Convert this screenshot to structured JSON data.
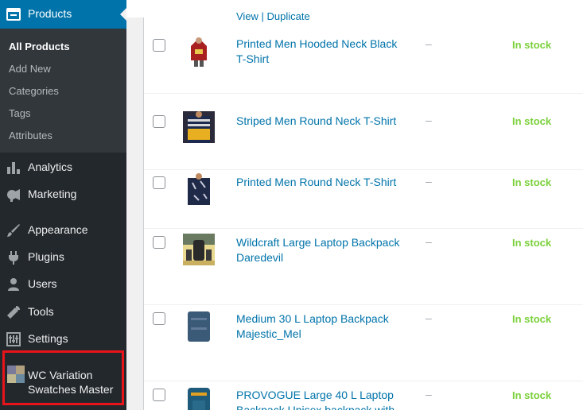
{
  "sidebar": {
    "products_label": "Products",
    "sub_items": [
      "All Products",
      "Add New",
      "Categories",
      "Tags",
      "Attributes"
    ],
    "menu": [
      {
        "label": "Analytics",
        "icon": "analytics-icon"
      },
      {
        "label": "Marketing",
        "icon": "megaphone-icon"
      },
      {
        "label": "Appearance",
        "icon": "brush-icon"
      },
      {
        "label": "Plugins",
        "icon": "plug-icon"
      },
      {
        "label": "Users",
        "icon": "user-icon"
      },
      {
        "label": "Tools",
        "icon": "wrench-icon"
      },
      {
        "label": "Settings",
        "icon": "settings-icon"
      }
    ],
    "wcv_line1": "WC Variation",
    "wcv_line2": "Swatches Master"
  },
  "colors": {
    "sidebar": "#23282d",
    "active": "#0073aa",
    "link": "#0073aa",
    "in_stock": "#7ad03a",
    "highlight_border": "#e8141a"
  },
  "top_row_actions": "View | Duplicate",
  "products": [
    {
      "name_line1": "Printed Men Hooded Neck Black",
      "name_line2": "T-Shirt",
      "price": "–",
      "stock": "In stock"
    },
    {
      "name_line1": "Striped Men Round Neck T-Shirt",
      "name_line2": "",
      "price": "–",
      "stock": "In stock"
    },
    {
      "name_line1": "Printed Men Round Neck T-Shirt",
      "name_line2": "",
      "price": "–",
      "stock": "In stock"
    },
    {
      "name_line1": "Wildcraft Large Laptop Backpack",
      "name_line2": "Daredevil",
      "price": "–",
      "stock": "In stock"
    },
    {
      "name_line1": "Medium 30 L Laptop Backpack",
      "name_line2": "Majestic_Mel",
      "price": "–",
      "stock": "In stock"
    },
    {
      "name_line1": "PROVOGUE Large 40 L Laptop",
      "name_line2": "Backpack Unisex backpack with",
      "price": "–",
      "stock": "In stock"
    }
  ]
}
